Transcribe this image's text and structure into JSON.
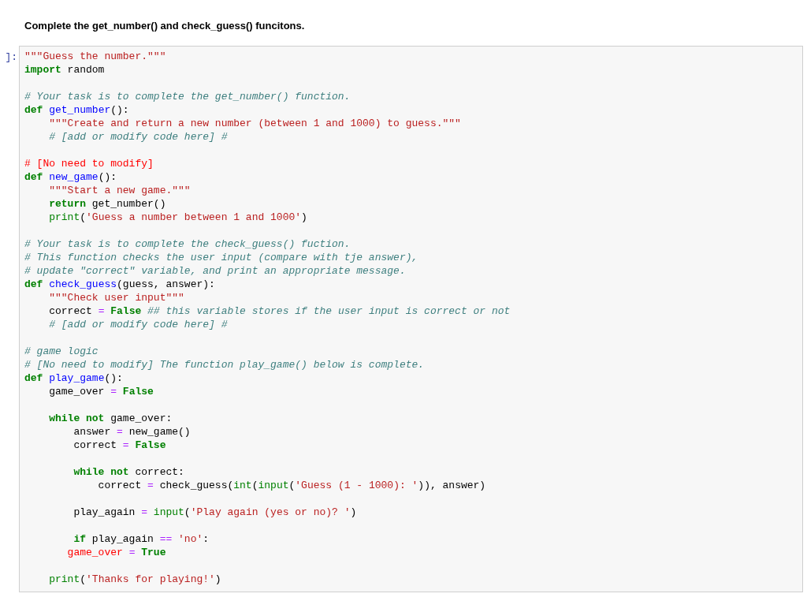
{
  "instruction": "Complete the get_number() and check_guess() funcitons.",
  "cell": {
    "prompt": "]:",
    "lines": [
      {
        "kind": "code",
        "tokens": [
          {
            "kind": "str",
            "text": "\"\"\"Guess the number.\"\"\""
          }
        ]
      },
      {
        "kind": "code",
        "tokens": [
          {
            "kind": "kw",
            "text": "import"
          },
          {
            "kind": "p",
            "text": " random"
          }
        ]
      },
      {
        "kind": "blank"
      },
      {
        "kind": "code",
        "tokens": [
          {
            "kind": "com",
            "text": "# Your task is to complete the get_number() function."
          }
        ]
      },
      {
        "kind": "code",
        "tokens": [
          {
            "kind": "kw",
            "text": "def "
          },
          {
            "kind": "fn",
            "text": "get_number"
          },
          {
            "kind": "p",
            "text": "():"
          }
        ]
      },
      {
        "kind": "code",
        "tokens": [
          {
            "kind": "str",
            "text": "    \"\"\"Create and return a new number (between 1 and 1000) to guess.\"\"\""
          }
        ]
      },
      {
        "kind": "code",
        "tokens": [
          {
            "kind": "com",
            "text": "    # [add or modify code here] #"
          }
        ]
      },
      {
        "kind": "blank"
      },
      {
        "kind": "code",
        "tokens": [
          {
            "kind": "err",
            "text": "# [No need to modify]"
          }
        ]
      },
      {
        "kind": "code",
        "tokens": [
          {
            "kind": "kw",
            "text": "def "
          },
          {
            "kind": "fn",
            "text": "new_game"
          },
          {
            "kind": "p",
            "text": "():"
          }
        ]
      },
      {
        "kind": "code",
        "tokens": [
          {
            "kind": "str",
            "text": "    \"\"\"Start a new game.\"\"\""
          }
        ]
      },
      {
        "kind": "code",
        "tokens": [
          {
            "kind": "kw",
            "text": "    return"
          },
          {
            "kind": "p",
            "text": " get_number()"
          }
        ]
      },
      {
        "kind": "code",
        "tokens": [
          {
            "kind": "bi",
            "text": "    print"
          },
          {
            "kind": "p",
            "text": "("
          },
          {
            "kind": "str",
            "text": "'Guess a number between 1 and 1000'"
          },
          {
            "kind": "p",
            "text": ")"
          }
        ]
      },
      {
        "kind": "blank"
      },
      {
        "kind": "code",
        "tokens": [
          {
            "kind": "com",
            "text": "# Your task is to complete the check_guess() fuction."
          }
        ]
      },
      {
        "kind": "code",
        "tokens": [
          {
            "kind": "com",
            "text": "# This function checks the user input (compare with tje answer),"
          }
        ]
      },
      {
        "kind": "code",
        "tokens": [
          {
            "kind": "com",
            "text": "# update \"correct\" variable, and print an appropriate message."
          }
        ]
      },
      {
        "kind": "code",
        "tokens": [
          {
            "kind": "kw",
            "text": "def "
          },
          {
            "kind": "fn",
            "text": "check_guess"
          },
          {
            "kind": "p",
            "text": "(guess, answer):"
          }
        ]
      },
      {
        "kind": "code",
        "tokens": [
          {
            "kind": "str",
            "text": "    \"\"\"Check user input\"\"\""
          }
        ]
      },
      {
        "kind": "code",
        "tokens": [
          {
            "kind": "p",
            "text": "    correct "
          },
          {
            "kind": "op",
            "text": "= "
          },
          {
            "kind": "kw",
            "text": "False "
          },
          {
            "kind": "com",
            "text": "## this variable stores if the user input is correct or not"
          }
        ]
      },
      {
        "kind": "code",
        "tokens": [
          {
            "kind": "com",
            "text": "    # [add or modify code here] #"
          }
        ]
      },
      {
        "kind": "blank"
      },
      {
        "kind": "code",
        "tokens": [
          {
            "kind": "com",
            "text": "# game logic"
          }
        ]
      },
      {
        "kind": "code",
        "tokens": [
          {
            "kind": "com",
            "text": "# [No need to modify] The function play_game() below is complete."
          }
        ]
      },
      {
        "kind": "code",
        "tokens": [
          {
            "kind": "kw",
            "text": "def "
          },
          {
            "kind": "fn",
            "text": "play_game"
          },
          {
            "kind": "p",
            "text": "():"
          }
        ]
      },
      {
        "kind": "code",
        "tokens": [
          {
            "kind": "p",
            "text": "    game_over "
          },
          {
            "kind": "op",
            "text": "= "
          },
          {
            "kind": "kw",
            "text": "False"
          }
        ]
      },
      {
        "kind": "blank"
      },
      {
        "kind": "code",
        "tokens": [
          {
            "kind": "kw",
            "text": "    while not"
          },
          {
            "kind": "p",
            "text": " game_over:"
          }
        ]
      },
      {
        "kind": "code",
        "tokens": [
          {
            "kind": "p",
            "text": "        answer "
          },
          {
            "kind": "op",
            "text": "="
          },
          {
            "kind": "p",
            "text": " new_game()"
          }
        ]
      },
      {
        "kind": "code",
        "tokens": [
          {
            "kind": "p",
            "text": "        correct "
          },
          {
            "kind": "op",
            "text": "= "
          },
          {
            "kind": "kw",
            "text": "False"
          }
        ]
      },
      {
        "kind": "blank"
      },
      {
        "kind": "code",
        "tokens": [
          {
            "kind": "kw",
            "text": "        while not"
          },
          {
            "kind": "p",
            "text": " correct:"
          }
        ]
      },
      {
        "kind": "code",
        "tokens": [
          {
            "kind": "p",
            "text": "            correct "
          },
          {
            "kind": "op",
            "text": "="
          },
          {
            "kind": "p",
            "text": " check_guess("
          },
          {
            "kind": "bi",
            "text": "int"
          },
          {
            "kind": "p",
            "text": "("
          },
          {
            "kind": "bi",
            "text": "input"
          },
          {
            "kind": "p",
            "text": "("
          },
          {
            "kind": "str",
            "text": "'Guess (1 - 1000): '"
          },
          {
            "kind": "p",
            "text": ")), answer)"
          }
        ]
      },
      {
        "kind": "blank"
      },
      {
        "kind": "code",
        "tokens": [
          {
            "kind": "p",
            "text": "        play_again "
          },
          {
            "kind": "op",
            "text": "= "
          },
          {
            "kind": "bi",
            "text": "input"
          },
          {
            "kind": "p",
            "text": "("
          },
          {
            "kind": "str",
            "text": "'Play again (yes or no)? '"
          },
          {
            "kind": "p",
            "text": ")"
          }
        ]
      },
      {
        "kind": "blank"
      },
      {
        "kind": "code",
        "tokens": [
          {
            "kind": "kw",
            "text": "        if"
          },
          {
            "kind": "p",
            "text": " play_again "
          },
          {
            "kind": "op",
            "text": "== "
          },
          {
            "kind": "str",
            "text": "'no'"
          },
          {
            "kind": "p",
            "text": ":"
          }
        ]
      },
      {
        "kind": "code",
        "tokens": [
          {
            "kind": "err",
            "text": "       game_over "
          },
          {
            "kind": "op",
            "text": "= "
          },
          {
            "kind": "kw",
            "text": "True"
          }
        ]
      },
      {
        "kind": "blank"
      },
      {
        "kind": "code",
        "tokens": [
          {
            "kind": "bi",
            "text": "    print"
          },
          {
            "kind": "p",
            "text": "("
          },
          {
            "kind": "str",
            "text": "'Thanks for playing!'"
          },
          {
            "kind": "p",
            "text": ")"
          }
        ]
      }
    ]
  }
}
